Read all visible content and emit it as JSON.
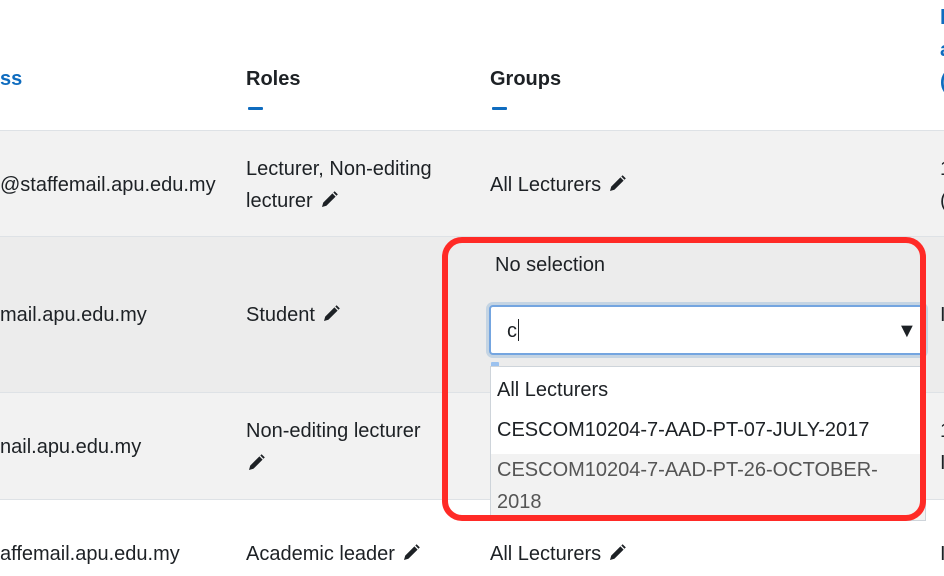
{
  "header": {
    "email_partial": "ss",
    "roles": "Roles",
    "groups": "Groups",
    "right_fragments": [
      "l",
      "a",
      "("
    ]
  },
  "rows": [
    {
      "email": "@staffemail.apu.edu.my",
      "roles_line1": "Lecturer, Non-editing",
      "roles_line2": "lecturer",
      "groups": "All Lecturers",
      "right_line1": "1",
      "right_line2": "("
    },
    {
      "email": "mail.apu.edu.my",
      "roles_line1": "Student",
      "right_line1": "I"
    },
    {
      "email": "nail.apu.edu.my",
      "roles_line1": "Non-editing lecturer",
      "right_line1": "1",
      "right_line2": "I"
    },
    {
      "email": "affemail.apu.edu.my",
      "roles_line1": "Academic leader",
      "groups": "All Lecturers",
      "right_line1": "I"
    }
  ],
  "group_editor": {
    "selection_label": "No selection",
    "input_value": "c",
    "arrow": "▼",
    "options": [
      "All Lecturers",
      "CESCOM10204-7-AAD-PT-07-JULY-2017",
      "CESCOM10204-7-AAD-PT-26-OCTOBER-",
      "2018"
    ]
  },
  "colors": {
    "link": "#0f6cbf",
    "highlight_box": "#ff2a26",
    "row_alt": "#f2f2f2"
  }
}
